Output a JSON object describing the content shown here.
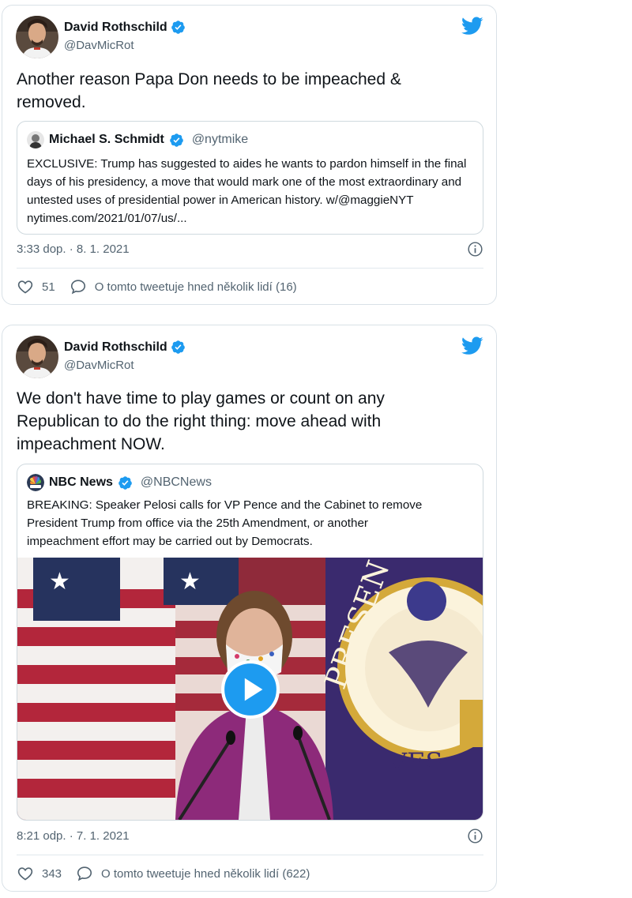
{
  "tweets": [
    {
      "author": {
        "name": "David Rothschild",
        "handle": "@DavMicRot",
        "avatar": "avatar-photo",
        "verified": true
      },
      "text": "Another reason Papa Don needs to be impeached & removed.",
      "quote": {
        "author": {
          "name": "Michael S. Schmidt",
          "handle": "@nytmike",
          "verified": true
        },
        "text": "EXCLUSIVE: Trump has suggested to aides he wants to pardon himself in the final days of his presidency, a move that would mark one of the most extraordinary and untested uses of presidential power in American history. w/@maggieNYT nytimes.com/2021/01/07/us/..."
      },
      "timestamp": "3:33 dop. · 8. 1. 2021",
      "likes": "51",
      "conversation": "O tomto tweetuje hned několik lidí (16)"
    },
    {
      "author": {
        "name": "David Rothschild",
        "handle": "@DavMicRot",
        "avatar": "avatar-photo",
        "verified": true
      },
      "text": "We don't have time to play games or count on any Republican to do the right thing: move ahead with impeachment NOW.",
      "quote": {
        "author": {
          "name": "NBC News",
          "handle": "@NBCNews",
          "verified": true
        },
        "text": "BREAKING: Speaker Pelosi calls for VP Pence and the Cabinet to remove President Trump from office via the 25th Amendment, or another impeachment effort may be carried out by Democrats.",
        "media": {
          "type": "video",
          "icon": "play-icon"
        }
      },
      "timestamp": "8:21 odp. · 7. 1. 2021",
      "likes": "343",
      "conversation": "O tomto tweetuje hned několik lidí (622)"
    }
  ],
  "colors": {
    "twitter_blue": "#1d9bf0",
    "text": "#0f1419",
    "secondary": "#536471",
    "border": "#d9e1e7"
  }
}
